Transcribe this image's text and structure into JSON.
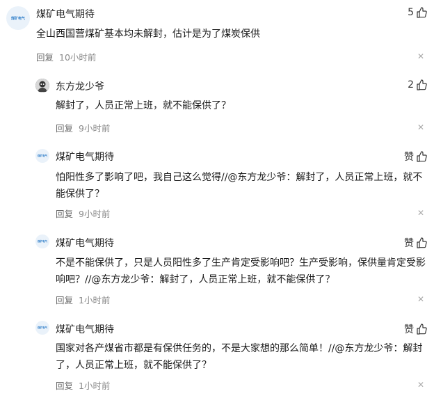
{
  "comments": [
    {
      "avatar": "煤矿电气",
      "user": "煤矿电气期待",
      "likes": "5",
      "text": "全山西国营煤矿基本均未解封，估计是为了煤炭保供",
      "reply_label": "回复",
      "time": "10小时前"
    },
    {
      "avatar": "",
      "user": "东方龙少爷",
      "likes": "2",
      "text": "解封了，人员正常上班，就不能保供了？",
      "reply_label": "回复",
      "time": "9小时前"
    },
    {
      "avatar": "煤矿电气",
      "user": "煤矿电气期待",
      "likes": "赞",
      "text": "怕阳性多了影响了吧，我自己这么觉得//@东方龙少爷：解封了，人员正常上班，就不能保供了？",
      "reply_label": "回复",
      "time": "9小时前"
    },
    {
      "avatar": "煤矿电气",
      "user": "煤矿电气期待",
      "likes": "赞",
      "text": "不是不能保供了，只是人员阳性多了生产肯定受影响吧？生产受影响，保供量肯定受影响吧？//@东方龙少爷：解封了，人员正常上班，就不能保供了？",
      "reply_label": "回复",
      "time": "1小时前"
    },
    {
      "avatar": "煤矿电气",
      "user": "煤矿电气期待",
      "likes": "赞",
      "text": "国家对各产煤省市都是有保供任务的，不是大家想的那么简单！//@东方龙少爷：解封了，人员正常上班，就不能保供了？",
      "reply_label": "回复",
      "time": "1小时前"
    }
  ],
  "icons": {
    "like": "thumbs-up-icon",
    "close": "close-icon"
  }
}
